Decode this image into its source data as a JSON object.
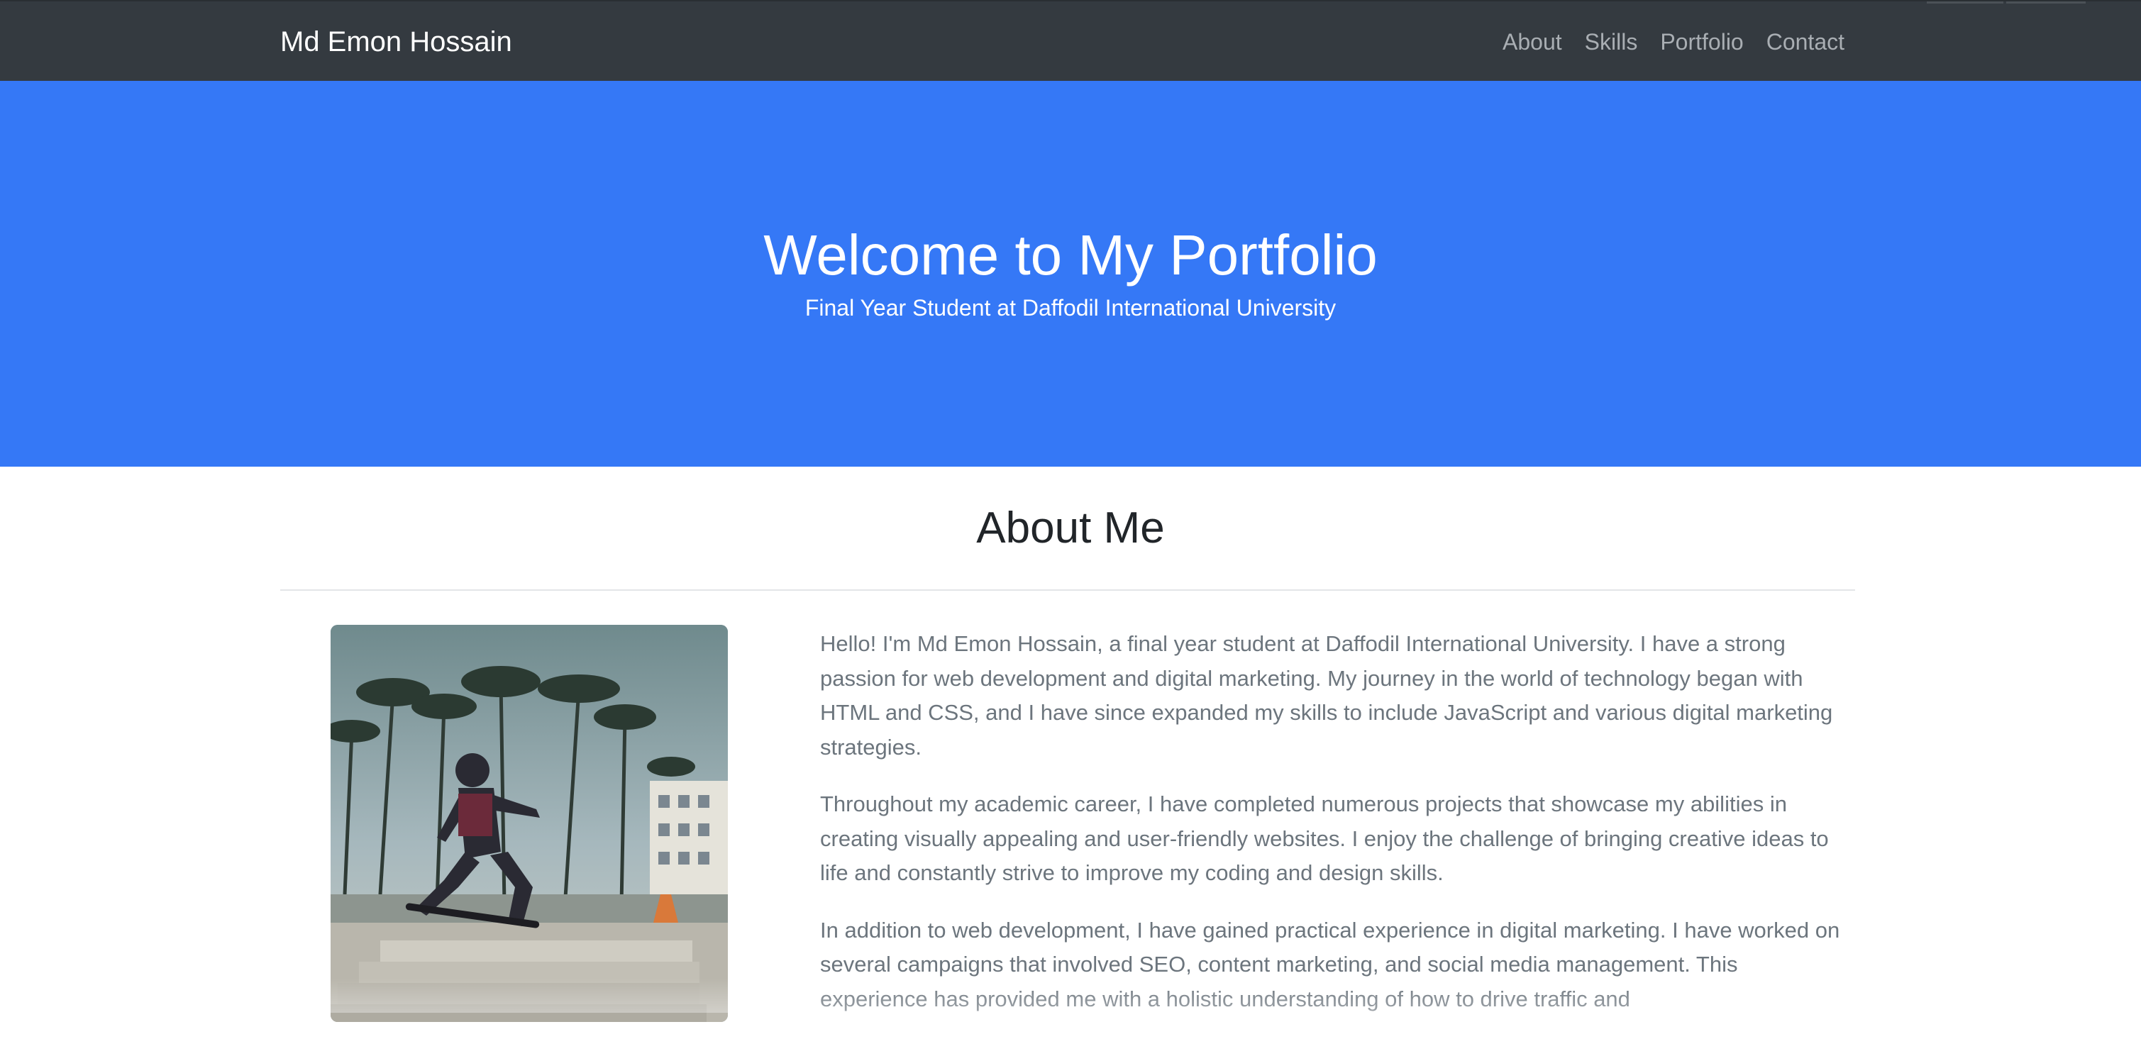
{
  "navbar": {
    "brand": "Md Emon Hossain",
    "links": [
      "About",
      "Skills",
      "Portfolio",
      "Contact"
    ]
  },
  "hero": {
    "title": "Welcome to My Portfolio",
    "subtitle": "Final Year Student at Daffodil International University"
  },
  "about": {
    "title": "About Me",
    "paragraphs": [
      "Hello! I'm Md Emon Hossain, a final year student at Daffodil International University. I have a strong passion for web development and digital marketing. My journey in the world of technology began with HTML and CSS, and I have since expanded my skills to include JavaScript and various digital marketing strategies.",
      "Throughout my academic career, I have completed numerous projects that showcase my abilities in creating visually appealing and user-friendly websites. I enjoy the challenge of bringing creative ideas to life and constantly strive to improve my coding and design skills.",
      "In addition to web development, I have gained practical experience in digital marketing. I have worked on several campaigns that involved SEO, content marketing, and social media management. This experience has provided me with a holistic understanding of how to drive traffic and"
    ]
  },
  "colors": {
    "navbar_bg": "#343a40",
    "hero_bg": "#3578f6",
    "body_text": "#6c757d",
    "heading_text": "#212529"
  }
}
